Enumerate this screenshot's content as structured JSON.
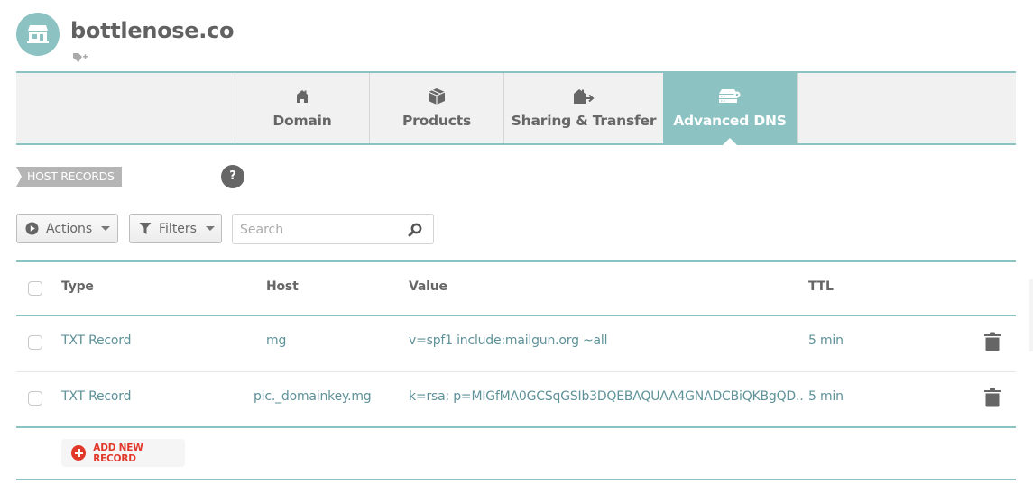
{
  "header": {
    "domain": "bottlenose.co",
    "avatar_icon": "storefront-icon",
    "tag_icon": "add-tag-icon",
    "brand_color": "#8cc2c1"
  },
  "tabs": [
    {
      "label": "Domain",
      "icon": "home-icon",
      "active": false
    },
    {
      "label": "Products",
      "icon": "box-icon",
      "active": false
    },
    {
      "label": "Sharing & Transfer",
      "icon": "transfer-icon",
      "active": false
    },
    {
      "label": "Advanced DNS",
      "icon": "dns-server-icon",
      "active": true
    }
  ],
  "section": {
    "label": "HOST RECORDS",
    "help": "?"
  },
  "toolbar": {
    "actions_label": "Actions",
    "filters_label": "Filters",
    "search_placeholder": "Search",
    "search_value": ""
  },
  "table": {
    "columns": [
      "Type",
      "Host",
      "Value",
      "TTL"
    ],
    "rows": [
      {
        "type": "TXT Record",
        "host": "mg",
        "value": "v=spf1 include:mailgun.org ~all",
        "ttl": "5 min"
      },
      {
        "type": "TXT Record",
        "host": "pic._domainkey.mg",
        "value": "k=rsa; p=MIGfMA0GCSqGSIb3DQEBAQUAA4GNADCBiQKBgQD..",
        "ttl": "5 min"
      }
    ]
  },
  "add_record": {
    "label": "ADD NEW RECORD",
    "accent": "#e1382a"
  }
}
